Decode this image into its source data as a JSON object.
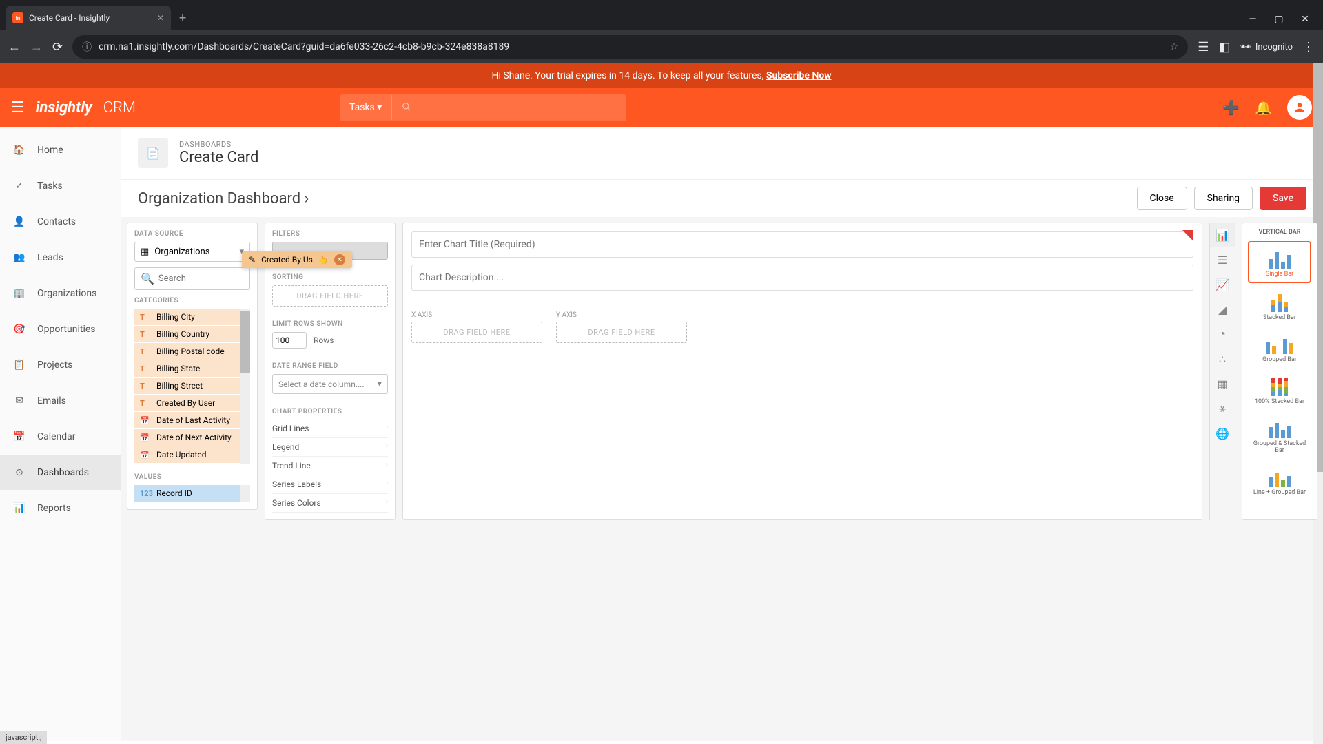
{
  "browser": {
    "tab_title": "Create Card - Insightly",
    "url": "crm.na1.insightly.com/Dashboards/CreateCard?guid=da6fe033-26c2-4cb8-b9cb-324e838a8189",
    "incognito_label": "Incognito"
  },
  "trial_banner": {
    "message": "Hi Shane. Your trial expires in 14 days. To keep all your features, ",
    "cta": "Subscribe Now"
  },
  "header": {
    "logo": "insightly",
    "product": "CRM",
    "search_category": "Tasks"
  },
  "sidebar": {
    "items": [
      {
        "label": "Home"
      },
      {
        "label": "Tasks"
      },
      {
        "label": "Contacts"
      },
      {
        "label": "Leads"
      },
      {
        "label": "Organizations"
      },
      {
        "label": "Opportunities"
      },
      {
        "label": "Projects"
      },
      {
        "label": "Emails"
      },
      {
        "label": "Calendar"
      },
      {
        "label": "Dashboards"
      },
      {
        "label": "Reports"
      }
    ]
  },
  "page": {
    "breadcrumb": "DASHBOARDS",
    "title": "Create Card",
    "dashboard_name": "Organization Dashboard",
    "close": "Close",
    "sharing": "Sharing",
    "save": "Save"
  },
  "data_source": {
    "label": "DATA SOURCE",
    "selected": "Organizations",
    "search_placeholder": "Search"
  },
  "categories": {
    "label": "CATEGORIES",
    "items": [
      {
        "type": "T",
        "label": "Billing City"
      },
      {
        "type": "T",
        "label": "Billing Country"
      },
      {
        "type": "T",
        "label": "Billing Postal code"
      },
      {
        "type": "T",
        "label": "Billing State"
      },
      {
        "type": "T",
        "label": "Billing Street"
      },
      {
        "type": "T",
        "label": "Created By User"
      },
      {
        "type": "D",
        "label": "Date of Last Activity"
      },
      {
        "type": "D",
        "label": "Date of Next Activity"
      },
      {
        "type": "D",
        "label": "Date Updated"
      }
    ]
  },
  "values": {
    "label": "VALUES",
    "items": [
      {
        "type": "123",
        "label": "Record ID"
      }
    ]
  },
  "filters": {
    "label": "FILTERS",
    "dragging_item": "Created By Us"
  },
  "sorting": {
    "label": "SORTING",
    "placeholder": "DRAG FIELD HERE"
  },
  "limit": {
    "label": "LIMIT ROWS SHOWN",
    "value": "100",
    "unit": "Rows"
  },
  "date_range": {
    "label": "DATE RANGE FIELD",
    "placeholder": "Select a date column...."
  },
  "chart_props": {
    "label": "CHART PROPERTIES",
    "items": [
      "Grid Lines",
      "Legend",
      "Trend Line",
      "Series Labels",
      "Series Colors"
    ]
  },
  "chart": {
    "title_placeholder": "Enter Chart Title (Required)",
    "desc_placeholder": "Chart Description....",
    "x_axis": "X AXIS",
    "y_axis": "Y AXIS",
    "drag_placeholder": "DRAG FIELD HERE"
  },
  "chart_types": {
    "header": "VERTICAL BAR",
    "items": [
      "Single Bar",
      "Stacked Bar",
      "Grouped Bar",
      "100% Stacked Bar",
      "Grouped & Stacked Bar",
      "Line + Grouped Bar"
    ]
  },
  "status_bar": "javascript:;"
}
